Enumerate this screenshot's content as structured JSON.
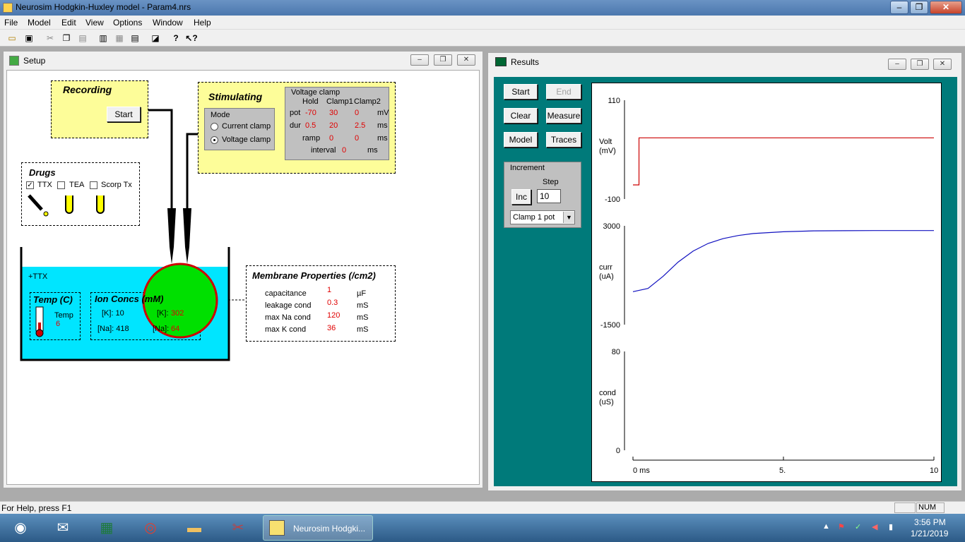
{
  "app": {
    "title": "Neurosim Hodgkin-Huxley model - Param4.nrs",
    "controls": {
      "minimize": "–",
      "maximize": "❐",
      "close": "✕"
    }
  },
  "menu": [
    "File",
    "Model",
    "Edit",
    "View",
    "Options",
    "Window",
    "Help"
  ],
  "setup": {
    "title": "Setup",
    "recording": {
      "title": "Recording",
      "start": "Start"
    },
    "stimulating": {
      "title": "Stimulating",
      "mode": {
        "title": "Mode",
        "options": [
          "Current clamp",
          "Voltage clamp"
        ],
        "selected": "Voltage clamp"
      },
      "vclamp": {
        "title": "Voltage clamp",
        "headers": [
          "Hold",
          "Clamp1",
          "Clamp2"
        ],
        "rows": [
          {
            "label": "pot",
            "values": [
              "-70",
              "30",
              "0"
            ],
            "unit": "mV"
          },
          {
            "label": "dur",
            "values": [
              "0.5",
              "20",
              "2.5"
            ],
            "unit": "ms"
          },
          {
            "label": "ramp",
            "values": [
              "0",
              "0"
            ],
            "unit": "ms"
          }
        ],
        "interval": {
          "label": "interval",
          "value": "0",
          "unit": "ms"
        }
      }
    },
    "drugs": {
      "title": "Drugs",
      "items": [
        {
          "label": "TTX",
          "checked": true
        },
        {
          "label": "TEA",
          "checked": false
        },
        {
          "label": "Scorp Tx",
          "checked": false
        }
      ]
    },
    "bath": {
      "label": "+TTX",
      "color": "#00e5ff"
    },
    "temp": {
      "title": "Temp (C)",
      "label": "Temp",
      "value": "6"
    },
    "ion": {
      "title": "Ion Concs (mM)",
      "k_out": "[K]: 10",
      "na_out": "[Na]: 418",
      "k_in_label": "[K]:",
      "k_in": "302",
      "na_in_label": "[Na]:",
      "na_in": "64"
    },
    "membrane": {
      "title": "Membrane Properties (/cm2)",
      "rows": [
        {
          "label": "capacitance",
          "value": "1",
          "unit": "µF"
        },
        {
          "label": "leakage cond",
          "value": "0.3",
          "unit": "mS"
        },
        {
          "label": "max Na cond",
          "value": "120",
          "unit": "mS"
        },
        {
          "label": "max K cond",
          "value": "36",
          "unit": "mS"
        }
      ]
    }
  },
  "results": {
    "title": "Results",
    "buttons": {
      "start": "Start",
      "end": "End",
      "clear": "Clear",
      "measure": "Measure",
      "model": "Model",
      "traces": "Traces"
    },
    "increment": {
      "title": "Increment",
      "inc": "Inc",
      "step_label": "Step",
      "step": "10",
      "select": "Clamp 1 pot"
    },
    "teal": "#007a7a"
  },
  "chart_data": [
    {
      "type": "line",
      "ylabel": "Volt\n(mV)",
      "ylim": [
        -100,
        110
      ],
      "ticks": [
        "110",
        "-100"
      ],
      "series": [
        {
          "color": "#cc0000",
          "x": [
            0,
            0.2,
            0.2,
            10
          ],
          "y": [
            -70,
            -70,
            30,
            30
          ]
        }
      ]
    },
    {
      "type": "line",
      "ylabel": "curr\n(uA)",
      "ylim": [
        -1500,
        3000
      ],
      "ticks": [
        "3000",
        "-1500"
      ],
      "series": [
        {
          "color": "#1010c0",
          "x": [
            0,
            0.5,
            1,
            1.5,
            2,
            2.5,
            3,
            3.5,
            4,
            5,
            6,
            7,
            8,
            10
          ],
          "y": [
            0,
            150,
            700,
            1350,
            1850,
            2200,
            2420,
            2560,
            2650,
            2730,
            2770,
            2780,
            2785,
            2785
          ]
        }
      ]
    },
    {
      "type": "line",
      "ylabel": "cond\n(uS)",
      "ylim": [
        0,
        80
      ],
      "ticks": [
        "80",
        "0"
      ],
      "series": []
    },
    {
      "type": "axis",
      "xlim": [
        0,
        10
      ],
      "xticks": [
        "0 ms",
        "5.",
        "10"
      ]
    }
  ],
  "status": {
    "help": "For Help, press F1",
    "num": "NUM"
  },
  "taskbar": {
    "task": "Neurosim Hodgki...",
    "time": "3:56 PM",
    "date": "1/21/2019"
  }
}
